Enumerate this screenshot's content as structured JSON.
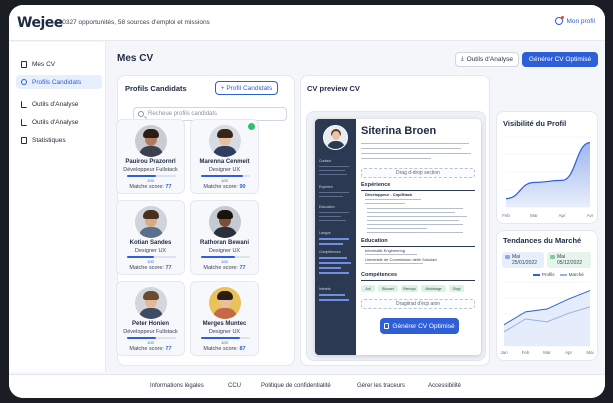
{
  "header": {
    "logo": "Wejee",
    "tagline": "180327 opportunités, 58 sources d'emploi et missions",
    "profile_link": "Mon profil"
  },
  "sidebar": {
    "items": [
      {
        "label": "Mes CV",
        "icon": "document-icon"
      },
      {
        "label": "Profils Candidats",
        "icon": "user-icon",
        "active": true
      },
      {
        "label": "Outils d'Analyse",
        "icon": "chart-icon"
      },
      {
        "label": "Outils d'Analyse",
        "icon": "chart-icon"
      },
      {
        "label": "Statistiques",
        "icon": "document-icon"
      }
    ]
  },
  "main": {
    "title": "Mes CV",
    "tools_button": "Outils d'Analyse",
    "generate_button": "Générer CV Optimisé"
  },
  "profiles": {
    "title": "Profils Candidats",
    "add_button": "+ Profil Candidats",
    "search_placeholder": "Recheue profils candidats",
    "cards": [
      {
        "name": "Pauirou Prazornrl",
        "role": "Développeur Fullstack",
        "progress": 0.6,
        "bar_value": "100",
        "score_label": "Matche score:",
        "score": "77"
      },
      {
        "name": "Marenna Cenmeit",
        "role": "Designer UX",
        "progress": 0.85,
        "bar_value": "100",
        "score_label": "Matche score:",
        "score": "90",
        "checked": true
      },
      {
        "name": "Kotian Sandes",
        "role": "Designer UX",
        "progress": 0.55,
        "bar_value": "100",
        "score_label": "Matche score:",
        "score": "77"
      },
      {
        "name": "Rathoran Bewani",
        "role": "Designer UX",
        "progress": 0.7,
        "bar_value": "100",
        "score_label": "Matche score:",
        "score": "77"
      },
      {
        "name": "Peter Honien",
        "role": "Développeur Fullstack",
        "progress": 0.6,
        "bar_value": "100",
        "score_label": "Matche score:",
        "score": "77"
      },
      {
        "name": "Merges Muntec",
        "role": "Designer UX",
        "progress": 0.8,
        "bar_value": "100",
        "score_label": "Matche score:",
        "score": "87"
      }
    ]
  },
  "cv_preview": {
    "title": "CV preview CV",
    "name": "Siterina Broen",
    "drop_top": "Drag d-drop section",
    "sections": {
      "experience": "Expérience",
      "exp_item": "Développeur - CopiStack",
      "education": "Education",
      "edu_item_1": "Informatik Engineering",
      "edu_item_2": "Université de Commission delle Sokolad",
      "skills": "Compétences"
    },
    "skills": [
      "Auf",
      "Blouset",
      "Remoys",
      "Mokistage",
      "Slogl"
    ],
    "side_labels": [
      "Contact",
      "Expérien",
      "Education",
      "Langue",
      "Compétences",
      "Intérêts"
    ],
    "drop_bottom": "Dragiinat d'écp aion",
    "generate_button": "Générer CV Optimisé"
  },
  "visibility": {
    "title": "Visibilité du Profil"
  },
  "market": {
    "title": "Tendances du Marché",
    "tag1_label": "Mai",
    "tag1_date": "25/01/2022",
    "tag2_label": "Mai",
    "tag2_date": "05/12/2022",
    "legend_1": "Profils",
    "legend_2": "Marché"
  },
  "chart_data": [
    {
      "type": "area",
      "x": [
        "Feb",
        "Mar",
        "Apr",
        "Avr"
      ],
      "ylim": [
        0,
        100
      ],
      "series": [
        {
          "values": [
            12,
            35,
            38,
            92
          ]
        }
      ]
    },
    {
      "type": "line",
      "x": [
        "Jan",
        "Feb",
        "Mar",
        "Apr",
        "Mai"
      ],
      "series": [
        {
          "name": "Profils",
          "values": [
            30,
            48,
            52,
            66,
            78
          ]
        },
        {
          "name": "Marché",
          "values": [
            20,
            38,
            34,
            46,
            55
          ]
        }
      ]
    }
  ],
  "footer": {
    "links": [
      "Informations légales",
      "CCU",
      "Politique de confidentialité",
      "Gérer les traceurs",
      "Accessibilité"
    ]
  },
  "colors": {
    "accent": "#2f5fd7",
    "sidebar_dark": "#2b3a52",
    "success": "#2fbf71"
  }
}
